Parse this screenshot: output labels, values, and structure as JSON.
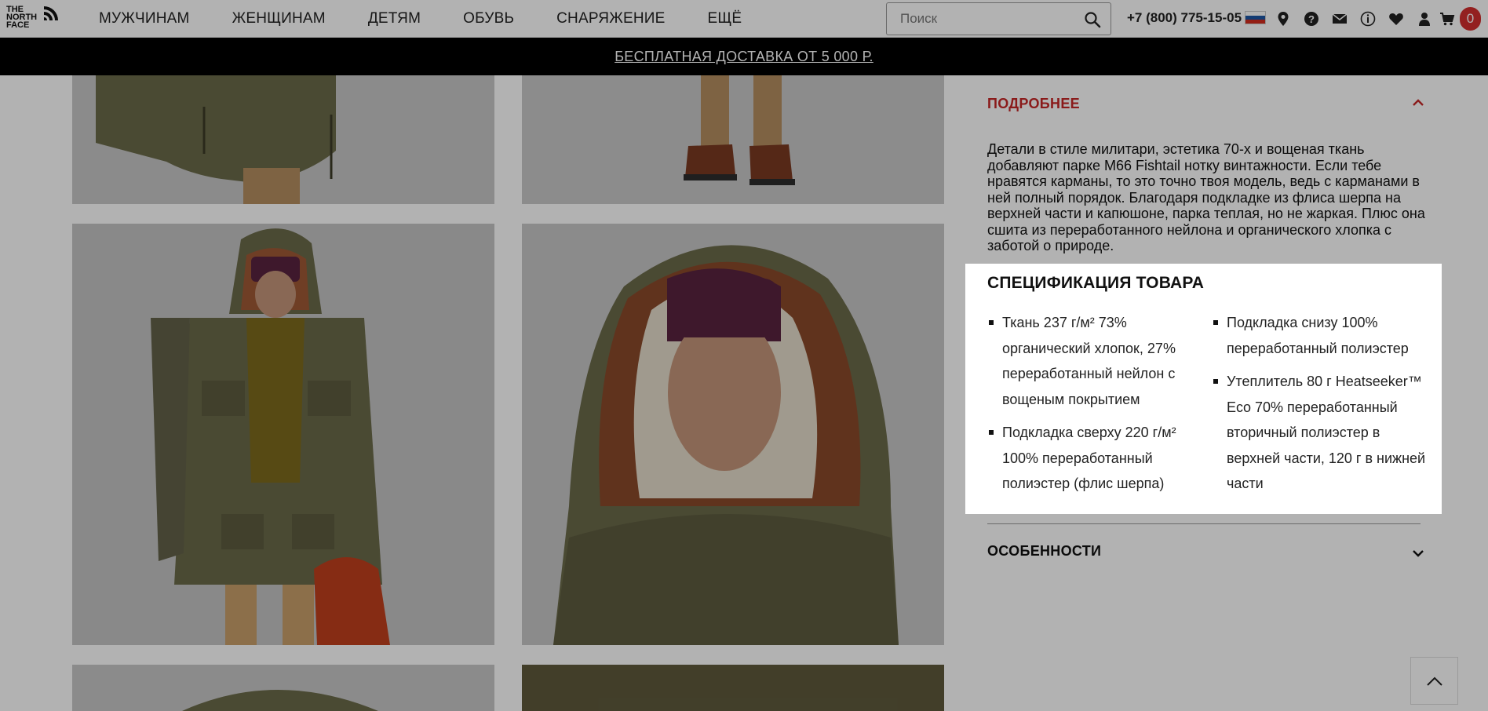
{
  "header": {
    "logo_lines": [
      "THE",
      "NORTH",
      "FACE"
    ],
    "nav": [
      "МУЖЧИНАМ",
      "ЖЕНЩИНАМ",
      "ДЕТЯМ",
      "ОБУВЬ",
      "СНАРЯЖЕНИЕ",
      "ЕЩЁ"
    ],
    "search_placeholder": "Поиск",
    "phone": "+7 (800) 775-15-05",
    "cart_count": "0"
  },
  "promo": {
    "text": "БЕСПЛАТНАЯ ДОСТАВКА ОТ 5 000 Р."
  },
  "details": {
    "title": "ПОДРОБНЕЕ",
    "description": "Детали в стиле милитари, эстетика 70-х и вощеная ткань добавляют парке M66 Fishtail нотку винтажности. Если тебе нравятся карманы, то это точно твоя модель, ведь с карманами в ней полный порядок. Благодаря подкладке из флиса шерпа на верхней части и капюшоне, парка теплая, но не жаркая. Плюс она сшита из переработанного нейлона и органического хлопка с заботой о природе."
  },
  "spec": {
    "title": "СПЕЦИФИКАЦИЯ ТОВАРА",
    "left": [
      "Ткань 237 г/м² 73% органический хлопок, 27% переработанный нейлон с вощеным покрытием",
      "Подкладка сверху 220 г/м² 100% переработанный полиэстер (флис шерпа)"
    ],
    "right": [
      "Подкладка снизу 100% переработанный полиэстер",
      "Утеплитель 80 г Heatseeker™ Eco 70% переработанный вторичный полиэстер в верхней части, 120 г в нижней части"
    ]
  },
  "features": {
    "title": "ОСОБЕННОСТИ"
  },
  "colors": {
    "accent_red": "#c62828",
    "promo_bg": "#000000",
    "olive": "#6b6a4a",
    "rust": "#8a4a2a",
    "burgundy": "#5a2340"
  }
}
